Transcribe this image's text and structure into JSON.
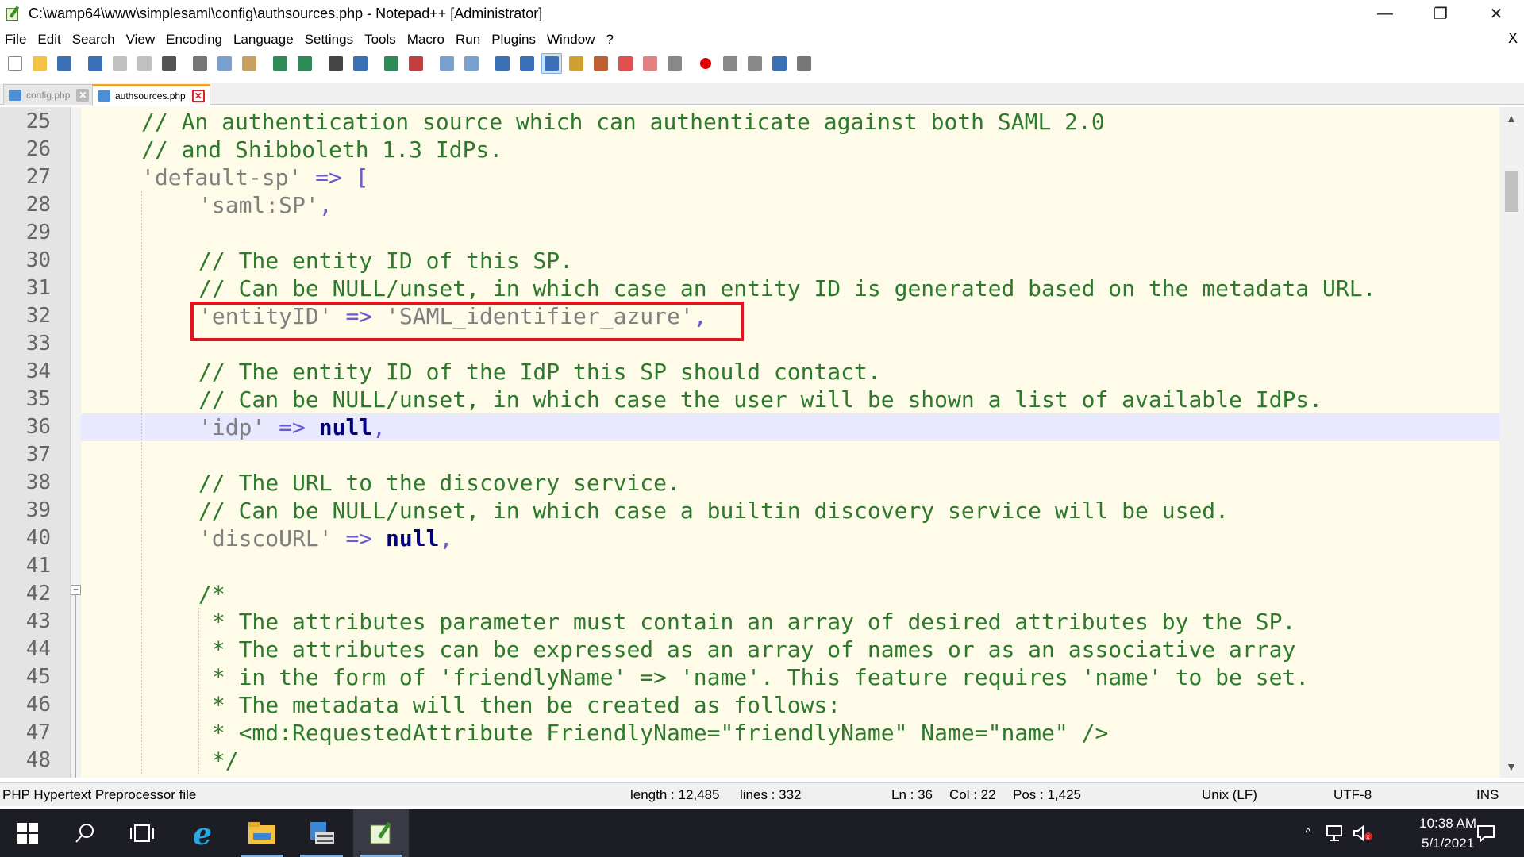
{
  "window": {
    "title": "C:\\wamp64\\www\\simplesaml\\config\\authsources.php - Notepad++ [Administrator]",
    "minimize": "—",
    "restore": "❐",
    "close": "✕"
  },
  "menu": {
    "items": [
      "File",
      "Edit",
      "Search",
      "View",
      "Encoding",
      "Language",
      "Settings",
      "Tools",
      "Macro",
      "Run",
      "Plugins",
      "Window",
      "?"
    ],
    "close_doc": "X"
  },
  "toolbar": {
    "icons": [
      "new-file-icon",
      "open-file-icon",
      "save-icon",
      "save-all-icon",
      "close-icon",
      "close-all-icon",
      "print-icon",
      "cut-icon",
      "copy-icon",
      "paste-icon",
      "undo-icon",
      "redo-icon",
      "find-icon",
      "replace-icon",
      "zoom-in-icon",
      "zoom-out-icon",
      "sync-v-icon",
      "sync-h-icon",
      "wrap-icon",
      "show-all-chars-icon",
      "indent-guide-icon",
      "udl-icon",
      "doc-map-icon",
      "function-list-icon",
      "folder-workspace-icon",
      "monitoring-icon",
      "record-macro-icon",
      "stop-macro-icon",
      "play-macro-icon",
      "run-macro-multiple-icon",
      "save-macro-icon"
    ]
  },
  "tabs": [
    {
      "label": "config.php",
      "active": false
    },
    {
      "label": "authsources.php",
      "active": true
    }
  ],
  "editor": {
    "lines": [
      {
        "n": "25",
        "indent": 1,
        "tokens": [
          {
            "t": "comment",
            "v": "// An authentication source which can authenticate against both SAML 2.0"
          }
        ]
      },
      {
        "n": "26",
        "indent": 1,
        "tokens": [
          {
            "t": "comment",
            "v": "// and Shibboleth 1.3 IdPs."
          }
        ]
      },
      {
        "n": "27",
        "indent": 1,
        "tokens": [
          {
            "t": "str",
            "v": "'default-sp'"
          },
          {
            "t": "txt",
            "v": " "
          },
          {
            "t": "op",
            "v": "=>"
          },
          {
            "t": "txt",
            "v": " "
          },
          {
            "t": "op",
            "v": "["
          }
        ]
      },
      {
        "n": "28",
        "indent": 2,
        "tokens": [
          {
            "t": "str",
            "v": "'saml:SP'"
          },
          {
            "t": "op",
            "v": ","
          }
        ]
      },
      {
        "n": "29",
        "indent": 0,
        "tokens": []
      },
      {
        "n": "30",
        "indent": 2,
        "tokens": [
          {
            "t": "comment",
            "v": "// The entity ID of this SP."
          }
        ]
      },
      {
        "n": "31",
        "indent": 2,
        "tokens": [
          {
            "t": "comment",
            "v": "// Can be NULL/unset, in which case an entity ID is generated based on the metadata URL."
          }
        ]
      },
      {
        "n": "32",
        "indent": 2,
        "tokens": [
          {
            "t": "str",
            "v": "'entityID'"
          },
          {
            "t": "txt",
            "v": " "
          },
          {
            "t": "op",
            "v": "=>"
          },
          {
            "t": "txt",
            "v": " "
          },
          {
            "t": "str",
            "v": "'SAML_identifier_azure'"
          },
          {
            "t": "op",
            "v": ","
          }
        ]
      },
      {
        "n": "33",
        "indent": 0,
        "tokens": []
      },
      {
        "n": "34",
        "indent": 2,
        "tokens": [
          {
            "t": "comment",
            "v": "// The entity ID of the IdP this SP should contact."
          }
        ]
      },
      {
        "n": "35",
        "indent": 2,
        "tokens": [
          {
            "t": "comment",
            "v": "// Can be NULL/unset, in which case the user will be shown a list of available IdPs."
          }
        ]
      },
      {
        "n": "36",
        "indent": 2,
        "current": true,
        "tokens": [
          {
            "t": "str",
            "v": "'idp'"
          },
          {
            "t": "txt",
            "v": " "
          },
          {
            "t": "op",
            "v": "=>"
          },
          {
            "t": "txt",
            "v": " "
          },
          {
            "t": "kw",
            "v": "null"
          },
          {
            "t": "op",
            "v": ","
          }
        ]
      },
      {
        "n": "37",
        "indent": 0,
        "tokens": []
      },
      {
        "n": "38",
        "indent": 2,
        "tokens": [
          {
            "t": "comment",
            "v": "// The URL to the discovery service."
          }
        ]
      },
      {
        "n": "39",
        "indent": 2,
        "tokens": [
          {
            "t": "comment",
            "v": "// Can be NULL/unset, in which case a builtin discovery service will be used."
          }
        ]
      },
      {
        "n": "40",
        "indent": 2,
        "tokens": [
          {
            "t": "str",
            "v": "'discoURL'"
          },
          {
            "t": "txt",
            "v": " "
          },
          {
            "t": "op",
            "v": "=>"
          },
          {
            "t": "txt",
            "v": " "
          },
          {
            "t": "kw",
            "v": "null"
          },
          {
            "t": "op",
            "v": ","
          }
        ]
      },
      {
        "n": "41",
        "indent": 0,
        "tokens": []
      },
      {
        "n": "42",
        "indent": 2,
        "tokens": [
          {
            "t": "comment",
            "v": "/*"
          }
        ]
      },
      {
        "n": "43",
        "indent": 2,
        "tokens": [
          {
            "t": "comment",
            "v": " * The attributes parameter must contain an array of desired attributes by the SP."
          }
        ]
      },
      {
        "n": "44",
        "indent": 2,
        "tokens": [
          {
            "t": "comment",
            "v": " * The attributes can be expressed as an array of names or as an associative array"
          }
        ]
      },
      {
        "n": "45",
        "indent": 2,
        "tokens": [
          {
            "t": "comment",
            "v": " * in the form of 'friendlyName' => 'name'. This feature requires 'name' to be set."
          }
        ]
      },
      {
        "n": "46",
        "indent": 2,
        "tokens": [
          {
            "t": "comment",
            "v": " * The metadata will then be created as follows:"
          }
        ]
      },
      {
        "n": "47",
        "indent": 2,
        "tokens": [
          {
            "t": "comment",
            "v": " * <md:RequestedAttribute FriendlyName=\"friendlyName\" Name=\"name\" />"
          }
        ]
      },
      {
        "n": "48",
        "indent": 2,
        "tokens": [
          {
            "t": "comment",
            "v": " */"
          }
        ]
      }
    ]
  },
  "statusbar": {
    "filetype": "PHP Hypertext Preprocessor file",
    "length": "length : 12,485",
    "lines": "lines : 332",
    "ln": "Ln : 36",
    "col": "Col : 22",
    "pos": "Pos : 1,425",
    "eol": "Unix (LF)",
    "encoding": "UTF-8",
    "mode": "INS"
  },
  "taskbar": {
    "time": "10:38 AM",
    "date": "5/1/2021"
  },
  "colors": {
    "editor_bg": "#fefbe8",
    "current_line": "#e8e8ff",
    "comment": "#2d7a2d",
    "string": "#808080",
    "keyword": "#000080",
    "highlight_box": "#e0141e"
  }
}
